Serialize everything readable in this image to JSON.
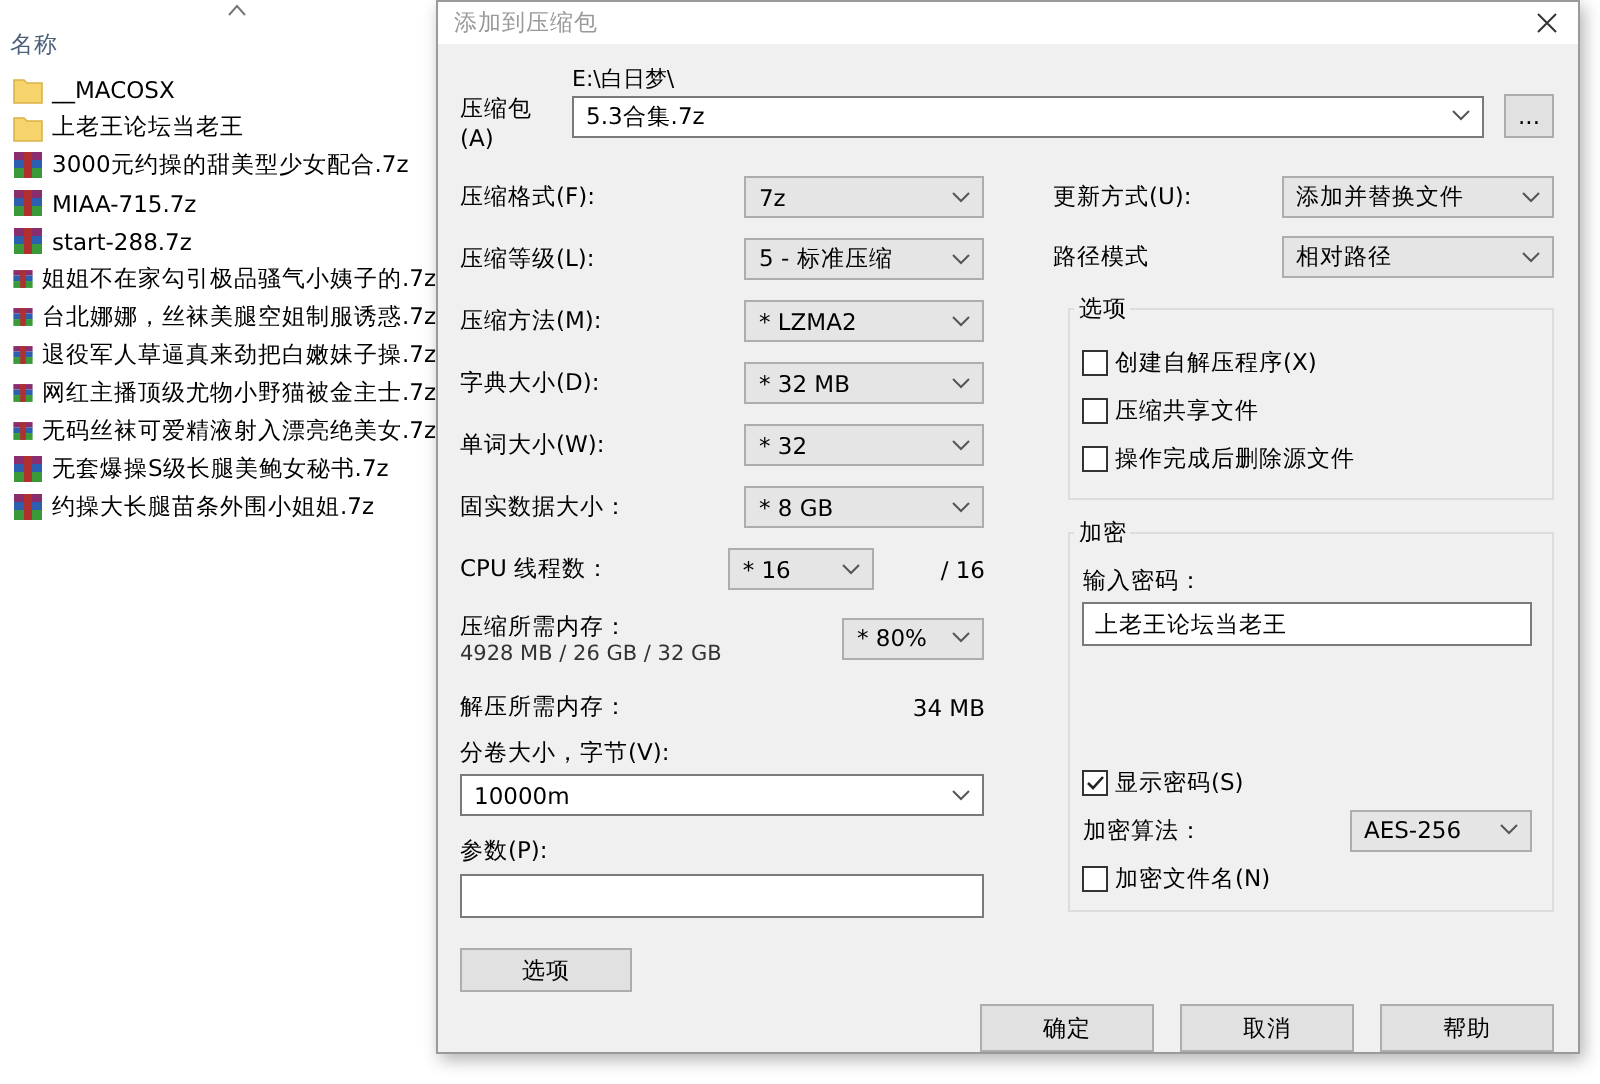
{
  "explorer": {
    "column_header": "名称",
    "files": [
      {
        "name": "__MACOSX",
        "kind": "folder"
      },
      {
        "name": "上老王论坛当老王",
        "kind": "folder"
      },
      {
        "name": "3000元约操的甜美型少女配合.7z",
        "kind": "archive"
      },
      {
        "name": "MIAA-715.7z",
        "kind": "archive"
      },
      {
        "name": "start-288.7z",
        "kind": "archive"
      },
      {
        "name": "姐姐不在家勾引极品骚气小姨子的.7z",
        "kind": "archive"
      },
      {
        "name": "台北娜娜，丝袜美腿空姐制服诱惑.7z",
        "kind": "archive"
      },
      {
        "name": "退役军人草逼真来劲把白嫩妹子操.7z",
        "kind": "archive"
      },
      {
        "name": "网红主播顶级尤物小野猫被金主士.7z",
        "kind": "archive"
      },
      {
        "name": "无码丝袜可爱精液射入漂亮绝美女.7z",
        "kind": "archive"
      },
      {
        "name": "无套爆操S级长腿美鲍女秘书.7z",
        "kind": "archive"
      },
      {
        "name": "约操大长腿苗条外围小姐姐.7z",
        "kind": "archive"
      }
    ]
  },
  "dialog": {
    "title": "添加到压缩包",
    "archive": {
      "label": "压缩包(A)",
      "path": "E:\\白日梦\\",
      "value": "5.3合集.7z",
      "browse_button": "..."
    },
    "settings": [
      {
        "label": "压缩格式(F):",
        "value": "7z"
      },
      {
        "label": "压缩等级(L):",
        "value": "5 - 标准压缩"
      },
      {
        "label": "压缩方法(M):",
        "value": "* LZMA2"
      },
      {
        "label": "字典大小(D):",
        "value": "* 32 MB"
      },
      {
        "label": "单词大小(W):",
        "value": "* 32"
      },
      {
        "label": "固实数据大小：",
        "value": "* 8 GB"
      }
    ],
    "cpu": {
      "label": "CPU 线程数：",
      "value": "* 16",
      "total": "/ 16"
    },
    "memory": {
      "label": "压缩所需内存：",
      "detail": "4928 MB / 26 GB / 32 GB",
      "value": "* 80%"
    },
    "decompress": {
      "label": "解压所需内存：",
      "value": "34 MB"
    },
    "volume": {
      "label": "分卷大小，字节(V):",
      "value": "10000m"
    },
    "params": {
      "label": "参数(P):"
    },
    "options_button": "选项",
    "update": [
      {
        "label": "更新方式(U):",
        "value": "添加并替换文件"
      },
      {
        "label": "路径模式",
        "value": "相对路径"
      }
    ],
    "options_group": {
      "title": "选项",
      "checkboxes": [
        {
          "label": "创建自解压程序(X)",
          "checked": false
        },
        {
          "label": "压缩共享文件",
          "checked": false
        },
        {
          "label": "操作完成后删除源文件",
          "checked": false
        }
      ]
    },
    "encryption": {
      "title": "加密",
      "password_label": "输入密码：",
      "password": "上老王论坛当老王",
      "show_password": {
        "label": "显示密码(S)",
        "checked": true
      },
      "method_label": "加密算法：",
      "method": "AES-256",
      "encrypt_names": {
        "label": "加密文件名(N)",
        "checked": false
      }
    },
    "buttons": [
      "确定",
      "取消",
      "帮助"
    ]
  }
}
